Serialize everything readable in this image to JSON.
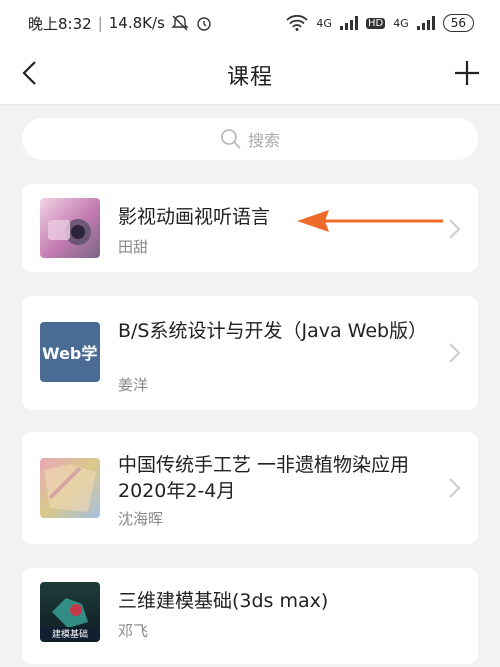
{
  "status": {
    "time": "晚上8:32",
    "speed": "14.8K/s",
    "battery": "56",
    "net1": "4G",
    "net2": "4G",
    "hd": "HD"
  },
  "nav": {
    "title": "课程"
  },
  "search": {
    "placeholder": "搜索"
  },
  "courses": [
    {
      "title": "影视动画视听语言",
      "teacher": "田甜",
      "thumb_icon": "camera-thumbnail"
    },
    {
      "title": "B/S系统设计与开发（Java Web版）",
      "teacher": "姜洋",
      "thumb_icon": "web-course-thumbnail",
      "thumb_text": "Web学"
    },
    {
      "title": "中国传统手工艺 一非遗植物染应用2020年2-4月",
      "teacher": "沈海晖",
      "thumb_icon": "fabric-thumbnail"
    },
    {
      "title": "三维建模基础(3ds max)",
      "teacher": "邓飞",
      "thumb_icon": "3d-model-thumbnail",
      "thumb_text": "建模基础"
    }
  ],
  "colors": {
    "annotation_arrow": "#ee6b2a",
    "background": "#f2f2f4"
  }
}
